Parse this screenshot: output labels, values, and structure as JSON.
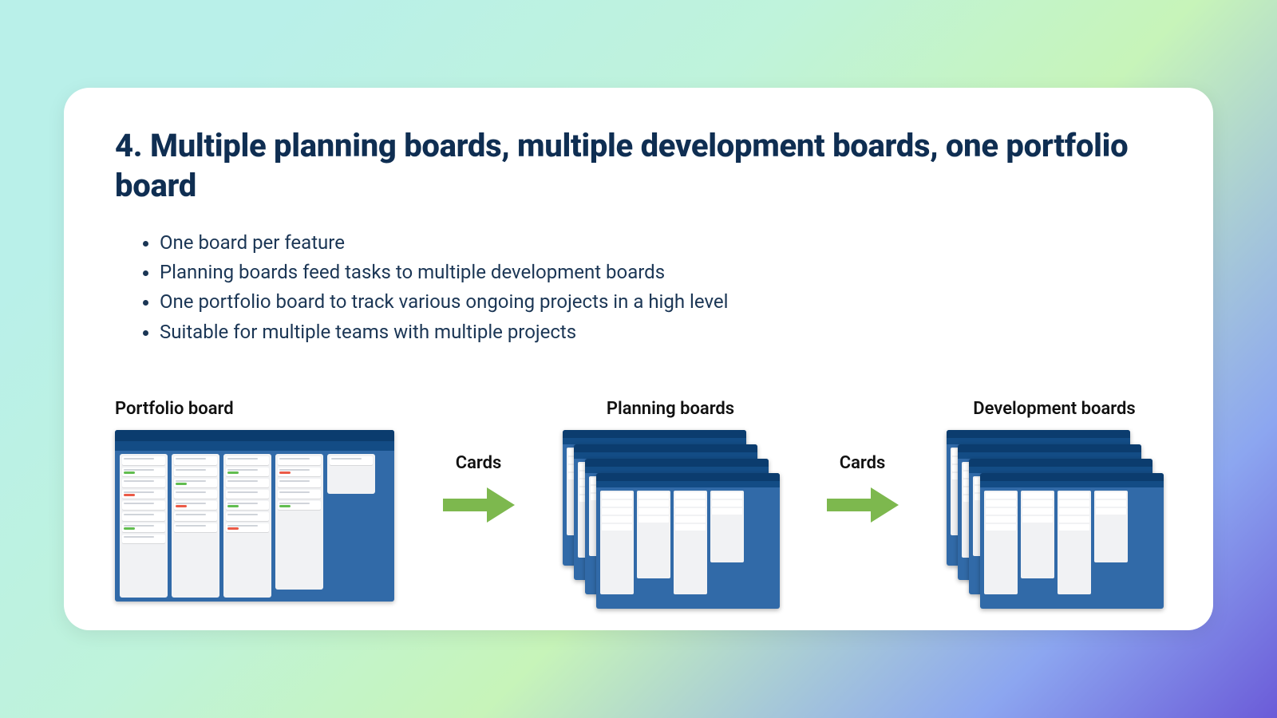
{
  "heading": "4. Multiple planning boards, multiple development boards, one portfolio board",
  "bullets": [
    "One board per feature",
    "Planning boards feed tasks to multiple development boards",
    "One portfolio board to track various ongoing projects in a high level",
    "Suitable for multiple teams with multiple projects"
  ],
  "labels": {
    "portfolio": "Portfolio board",
    "planning": "Planning boards",
    "development": "Development boards",
    "arrow": "Cards"
  },
  "colors": {
    "board_bg": "#316aa8",
    "arrow": "#7db84e",
    "heading": "#0f2e52"
  }
}
